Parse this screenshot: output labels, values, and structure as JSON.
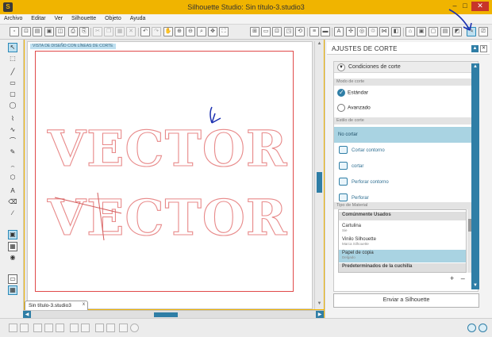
{
  "window": {
    "title": "Silhouette Studio: Sin título-3.studio3",
    "app_icon_glyph": "S",
    "min_glyph": "–",
    "max_glyph": "□",
    "close_glyph": "✕"
  },
  "menu": [
    "Archivo",
    "Editar",
    "Ver",
    "Silhouette",
    "Objeto",
    "Ayuda"
  ],
  "toolbar": {
    "left_icons": [
      "new-icon",
      "open-icon",
      "open-library-icon",
      "save-icon",
      "save-as-icon",
      "print-icon",
      "print-cut-icon",
      "cut-icon",
      "copy-icon",
      "paste-icon",
      "delete-icon",
      "undo-icon",
      "redo-icon",
      "pan-icon",
      "zoom-in-icon",
      "zoom-out-icon",
      "zoom-box-icon",
      "move-view-icon",
      "fit-page-icon"
    ],
    "right_icons": [
      "grid-icon",
      "page-setup-icon",
      "registration-icon",
      "cut-settings-icon",
      "replicate-icon",
      "line-style-icon",
      "fill-icon",
      "text-style-icon",
      "transform-icon",
      "offset-icon",
      "trace-icon",
      "store-icon",
      "library-icon",
      "send-to-silhouette-icon"
    ]
  },
  "left_tools": [
    "select-icon",
    "point-edit-icon",
    "line-icon",
    "rectangle-icon",
    "rounded-rectangle-icon",
    "ellipse-icon",
    "polygon-icon",
    "curve-icon",
    "arc-icon",
    "freehand-icon",
    "smooth-freehand-icon",
    "regular-polygon-icon",
    "text-icon",
    "eraser-icon",
    "knife-icon",
    "view-page-icon",
    "view-cut-mat-icon",
    "view-grid-icon",
    "preview-icon",
    "split-view-icon"
  ],
  "canvas": {
    "view_label": "VISTA DE DISEÑO CON LÍNEAS DE CORTE",
    "words": [
      "VECTOR",
      "VECTOR"
    ],
    "doc_tab": "Sin título-3.studio3",
    "doc_tab_close": "x"
  },
  "panel": {
    "title": "AJUSTES DE CORTE",
    "conditions_label": "Condiciones de corte",
    "cut_mode_section": "Modo de corte",
    "cut_modes": [
      {
        "label": "Estándar",
        "selected": true
      },
      {
        "label": "Avanzado",
        "selected": false
      }
    ],
    "cut_style_section": "Estilo de corte",
    "cut_styles": [
      {
        "label": "No cortar",
        "selected": true
      },
      {
        "label": "Cortar contorno",
        "selected": false
      },
      {
        "label": "cortar",
        "selected": false
      },
      {
        "label": "Perforar contorno",
        "selected": false
      },
      {
        "label": "Perforar",
        "selected": false
      }
    ],
    "material_section": "Tipo de Material",
    "materials": [
      {
        "name": "Comúnmente Usados",
        "sub": "",
        "kind": "category"
      },
      {
        "name": "Cartulina",
        "sub": "Sie",
        "kind": "item"
      },
      {
        "name": "Vinilo Silhouette",
        "sub": "Marca Silhouette",
        "kind": "item"
      },
      {
        "name": "Papel de copia",
        "sub": "Delgado",
        "kind": "selected"
      },
      {
        "name": "Predeterminados de la cuchilla",
        "sub": "",
        "kind": "category"
      }
    ],
    "add_glyph": "+",
    "remove_glyph": "–",
    "send_button": "Enviar a Silhouette"
  },
  "colors": {
    "title_bar": "#f0b400",
    "accent_blue": "#2f7ea6",
    "cut_line_red": "#e04a4a",
    "annotation_blue": "#1a2fb0"
  }
}
